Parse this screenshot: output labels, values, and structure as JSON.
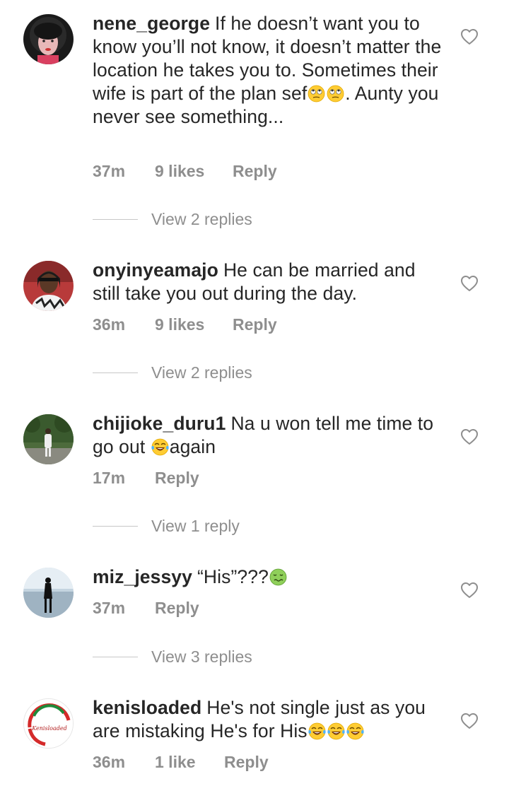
{
  "comments": [
    {
      "username": "nene_george",
      "text_parts": [
        {
          "type": "text",
          "value": "If he doesn’t want you to know you’ll not know, it doesn’t matter the location he takes you to. Sometimes their wife is part of the plan sef"
        },
        {
          "type": "emoji",
          "name": "eye-roll-emoji"
        },
        {
          "type": "emoji",
          "name": "eye-roll-emoji"
        },
        {
          "type": "text",
          "value": ". Aunty you never see something..."
        }
      ],
      "time": "37m",
      "likes": "9 likes",
      "reply": "Reply",
      "view_replies": "View 2 replies"
    },
    {
      "username": "onyinyeamajo",
      "text_parts": [
        {
          "type": "text",
          "value": "He can be married and still take you out during the day."
        }
      ],
      "time": "36m",
      "likes": "9 likes",
      "reply": "Reply",
      "view_replies": "View 2 replies"
    },
    {
      "username": "chijioke_duru1",
      "text_parts": [
        {
          "type": "text",
          "value": "Na u won tell me time to go out "
        },
        {
          "type": "emoji",
          "name": "tears-of-joy-emoji"
        },
        {
          "type": "text",
          "value": "again"
        }
      ],
      "time": "17m",
      "likes": "",
      "reply": "Reply",
      "view_replies": "View 1 reply"
    },
    {
      "username": "miz_jessyy",
      "text_parts": [
        {
          "type": "text",
          "value": "“His”???"
        },
        {
          "type": "emoji",
          "name": "nauseated-face-emoji"
        }
      ],
      "time": "37m",
      "likes": "",
      "reply": "Reply",
      "view_replies": "View 3 replies"
    },
    {
      "username": "kenisloaded",
      "text_parts": [
        {
          "type": "text",
          "value": "He's not single just as you are mistaking He's for His"
        },
        {
          "type": "emoji",
          "name": "tears-of-joy-emoji"
        },
        {
          "type": "emoji",
          "name": "tears-of-joy-emoji"
        },
        {
          "type": "emoji",
          "name": "tears-of-joy-emoji"
        }
      ],
      "time": "36m",
      "likes": "1 like",
      "reply": "Reply",
      "view_replies": "",
      "avatar_logo_text": "Kenisloaded"
    }
  ],
  "icons": {
    "like": "heart-outline-icon"
  },
  "colors": {
    "text": "#262626",
    "secondary": "#8e8e8e",
    "divider": "#c7c7c7"
  }
}
